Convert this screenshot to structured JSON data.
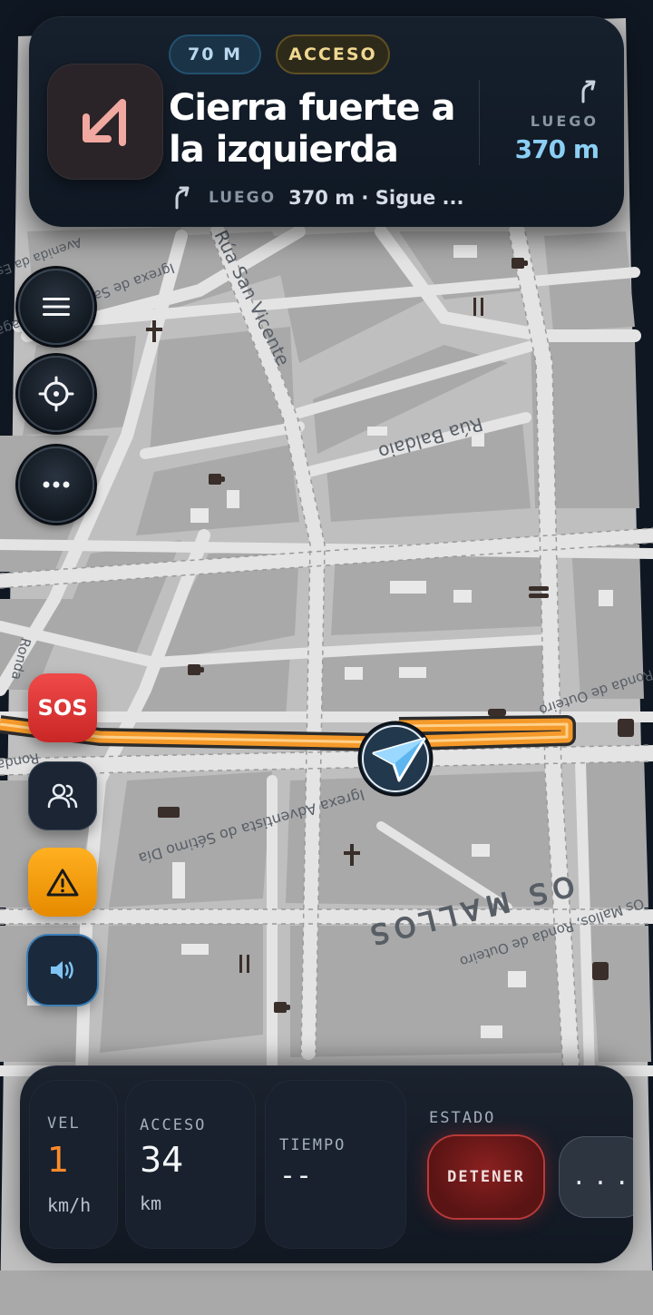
{
  "instruction": {
    "distance_pill": "70 M",
    "road_pill": "ACCESO",
    "text": "Cierra fuerte a la izquierda",
    "then_label": "LUEGO",
    "then_text": "370 m · Sigue ...",
    "next_label": "LUEGO",
    "next_distance": "370 m",
    "turn_icon": "sharp-left-arrow-icon",
    "next_icon": "slight-right-arrow-icon"
  },
  "map": {
    "street_labels": {
      "san_vicente": "Rúa San Vicente",
      "avenida_estacion": "Avenida da Estación",
      "igrexa_san_luis": "Igrexa de San Luis Gonzaga",
      "rua_baldaio": "Rúa Baldaio",
      "ronda_left": "Ronda",
      "ronda_quenro": "Ronda de Outeiro",
      "igrexa_adventista": "Igrexa Adventista do Sétimo Día",
      "os_mallos_big": "OS MALLOS",
      "os_mallos_small": "Os Mallos, Ronda de Outeiro",
      "rolda_outeiro": "Ronda de Outeiro"
    },
    "route_color": "#f59a2a",
    "vehicle_icon": "navigation-arrow-icon"
  },
  "controls": {
    "menu_icon": "hamburger-menu-icon",
    "recenter_icon": "crosshair-icon",
    "more_icon": "more-dots-icon",
    "sos_label": "SOS",
    "people_icon": "people-icon",
    "warning_icon": "warning-icon",
    "sound_icon": "speaker-icon"
  },
  "dashboard": {
    "speed_label": "VEL",
    "speed_value": "1",
    "speed_unit": "km/h",
    "road_label": "ACCESO",
    "road_value": "34",
    "road_unit": "km",
    "time_label": "TIEMPO",
    "time_value": "--",
    "status_label": "ESTADO",
    "stop_label": "DETENER",
    "more_label": "..."
  },
  "colors": {
    "accent_blue": "#8ccff4",
    "speed_orange": "#ff8a2a",
    "sos_red": "#e23b3b",
    "warning_orange": "#ffb020"
  }
}
